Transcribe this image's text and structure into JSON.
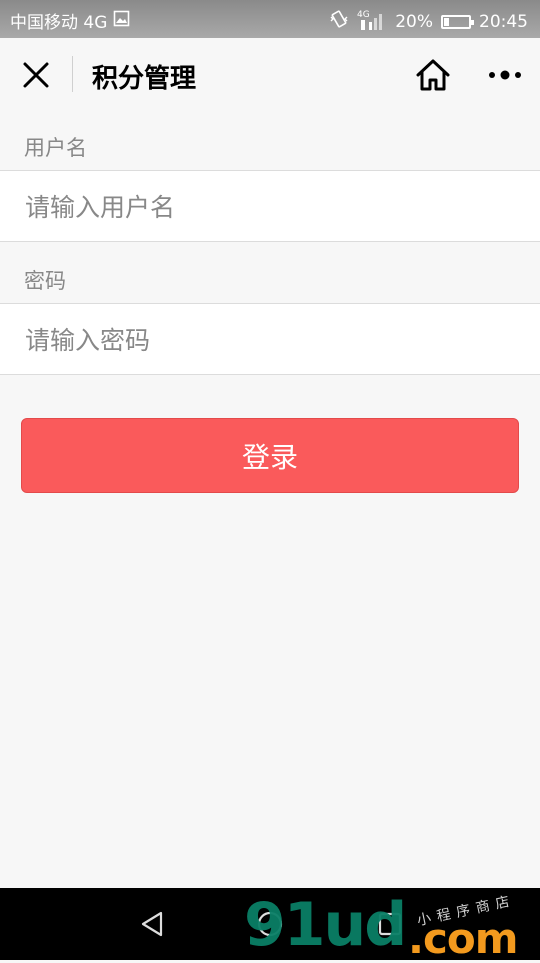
{
  "status_bar": {
    "carrier": "中国移动 4G",
    "network_small": "4G",
    "battery": "20%",
    "battery_level": 0.2,
    "time": "20:45"
  },
  "navbar": {
    "title": "积分管理",
    "close_icon": "close-icon",
    "home_icon": "home-icon",
    "more_icon": "more-icon"
  },
  "form": {
    "username_label": "用户名",
    "username_placeholder": "请输入用户名",
    "password_label": "密码",
    "password_placeholder": "请输入密码",
    "login_label": "登录"
  },
  "colors": {
    "accent": "#fa5a5b",
    "watermark_green": "#0a7f66",
    "watermark_orange": "#f39a1e"
  },
  "watermark": {
    "main": "91ud",
    "suffix": ".com",
    "small": "小程序商店"
  }
}
